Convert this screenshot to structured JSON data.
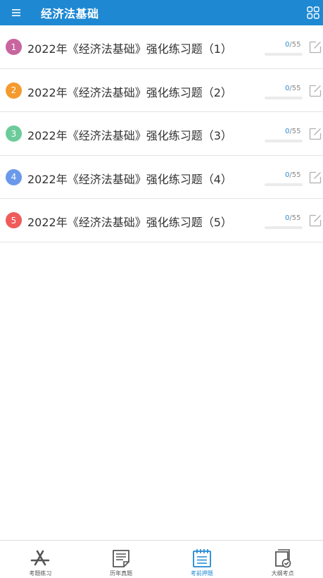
{
  "header": {
    "title": "经济法基础"
  },
  "colors": {
    "accent": "#1e88d2",
    "progress": "#2a8ed8"
  },
  "items": [
    {
      "index": "1",
      "title": "2022年《经济法基础》强化练习题（1）",
      "done": "0",
      "total": "/55",
      "progress": 0,
      "color": "#c8659e"
    },
    {
      "index": "2",
      "title": "2022年《经济法基础》强化练习题（2）",
      "done": "0",
      "total": "/55",
      "progress": 0,
      "color": "#f49a2e"
    },
    {
      "index": "3",
      "title": "2022年《经济法基础》强化练习题（3）",
      "done": "0",
      "total": "/55",
      "progress": 0,
      "color": "#6ccb9a"
    },
    {
      "index": "4",
      "title": "2022年《经济法基础》强化练习题（4）",
      "done": "0",
      "total": "/55",
      "progress": 0,
      "color": "#6b99ea"
    },
    {
      "index": "5",
      "title": "2022年《经济法基础》强化练习题（5）",
      "done": "0",
      "total": "/55",
      "progress": 0,
      "color": "#ef5a5a"
    }
  ],
  "tabs": [
    {
      "label": "考题练习",
      "icon": "app-store-icon"
    },
    {
      "label": "历年真题",
      "icon": "exam-paper-icon"
    },
    {
      "label": "考前押题",
      "icon": "notepad-icon"
    },
    {
      "label": "大纲考点",
      "icon": "syllabus-check-icon"
    }
  ],
  "active_tab": 2
}
